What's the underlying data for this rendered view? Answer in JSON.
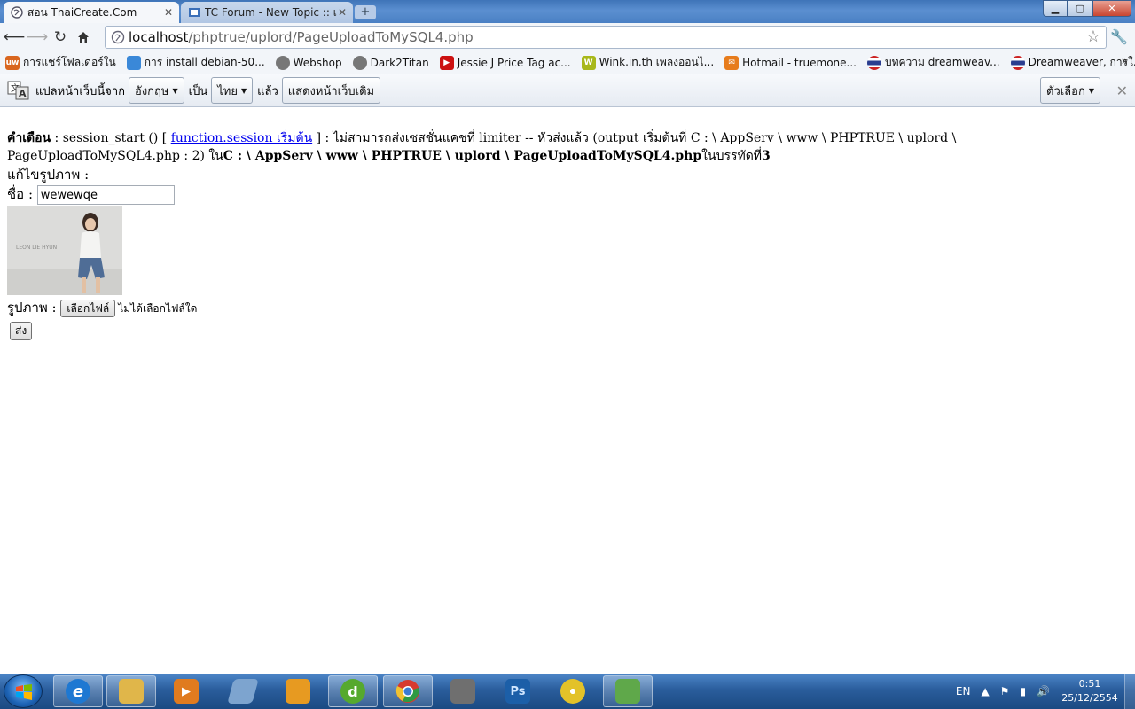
{
  "browser": {
    "tabs": [
      {
        "title": "สอน ThaiCreate.Com",
        "active": true
      },
      {
        "title": "TC Forum - New Topic :: เร",
        "active": false
      }
    ],
    "new_tab_symbol": "+",
    "window_controls": {
      "minimize": "▁",
      "maximize": "▢",
      "close": "✕"
    },
    "address": {
      "host": "localhost",
      "path": "/phptrue/uplord/PageUploadToMySQL4.php"
    },
    "bookmarks": [
      {
        "label": "การแชร์โฟลเดอร์ใน",
        "icon": "uw-icon",
        "icon_text": "uw",
        "color": "#d9661f"
      },
      {
        "label": "การ install debian-50...",
        "icon": "page-icon",
        "icon_text": "",
        "color": "#3a88d8"
      },
      {
        "label": "Webshop",
        "icon": "globe-icon",
        "icon_text": "",
        "color": "#777777"
      },
      {
        "label": "Dark2Titan",
        "icon": "globe-icon",
        "icon_text": "",
        "color": "#777777"
      },
      {
        "label": "Jessie J Price Tag ac...",
        "icon": "youtube-icon",
        "icon_text": "▶",
        "color": "#cc1111"
      },
      {
        "label": "Wink.in.th เพลงออนไ...",
        "icon": "w-icon",
        "icon_text": "W",
        "color": "#a8b81a"
      },
      {
        "label": "Hotmail - truemone...",
        "icon": "hotmail-icon",
        "icon_text": "✉",
        "color": "#e77c1c"
      },
      {
        "label": "บทความ dreamweav...",
        "icon": "thai-flag-icon",
        "icon_text": "",
        "color": "#2a3d8f"
      },
      {
        "label": "Dreamweaver, การใ...",
        "icon": "thai-flag-icon",
        "icon_text": "",
        "color": "#2a3d8f"
      }
    ],
    "bookmarks_more": "»"
  },
  "translate_bar": {
    "prefix": "แปลหน้าเว็บนี้จาก",
    "from_language": "อังกฤษ",
    "middle": "เป็น",
    "to_language": "ไทย",
    "suffix": "แล้ว",
    "show_original": "แสดงหน้าเว็บเดิม",
    "options": "ตัวเลือก",
    "close": "✕"
  },
  "page": {
    "warning_label": "คำเตือน",
    "warning_part1": " : session_start () [ ",
    "warning_link": "function.session เริ่มต้น",
    "warning_part2": " ] : ไม่สามารถส่งเซสชั่นแคชที่ limiter -- หัวส่งแล้ว (output เริ่มต้นที่ C : \\ AppServ \\ www \\ PHPTRUE \\ uplord \\ PageUploadToMySQL4.php : 2) ใน",
    "warning_path": "C : \\ AppServ \\ www \\ PHPTRUE \\ uplord \\ PageUploadToMySQL4.php",
    "warning_line_prefix": "ในบรรทัดที่",
    "warning_line": "3",
    "edit_heading": "แก้ไขรูปภาพ :",
    "name_label": "ชื่อ :",
    "name_value": "wewewqe",
    "photo_caption": "LEON LIE HYUN",
    "picture_label": "รูปภาพ :",
    "choose_file": "เลือกไฟล์",
    "no_file": "ไม่ได้เลือกไฟล์ใด",
    "submit": "ส่ง"
  },
  "taskbar": {
    "apps": [
      {
        "name": "ie-icon",
        "text": "e",
        "color": "#1e78d2"
      },
      {
        "name": "explorer-icon",
        "text": "",
        "color": "#e0b64a"
      },
      {
        "name": "media-player-icon",
        "text": "▶",
        "color": "#e07b1f"
      },
      {
        "name": "scanner-icon",
        "text": "",
        "color": "#7da4cf"
      },
      {
        "name": "window-app-icon",
        "text": "",
        "color": "#e79a21"
      },
      {
        "name": "dreamweaver-icon",
        "text": "d",
        "color": "#56a92e"
      },
      {
        "name": "chrome-icon",
        "text": "",
        "color": "#d73a2f"
      },
      {
        "name": "device-icon",
        "text": "",
        "color": "#6f6f6f"
      },
      {
        "name": "photoshop-icon",
        "text": "Ps",
        "color": "#1c5fa8"
      },
      {
        "name": "disc-icon",
        "text": "",
        "color": "#e3c229"
      },
      {
        "name": "network-users-icon",
        "text": "",
        "color": "#5fa84a"
      }
    ],
    "language": "EN",
    "time": "0:51",
    "date": "25/12/2554"
  }
}
